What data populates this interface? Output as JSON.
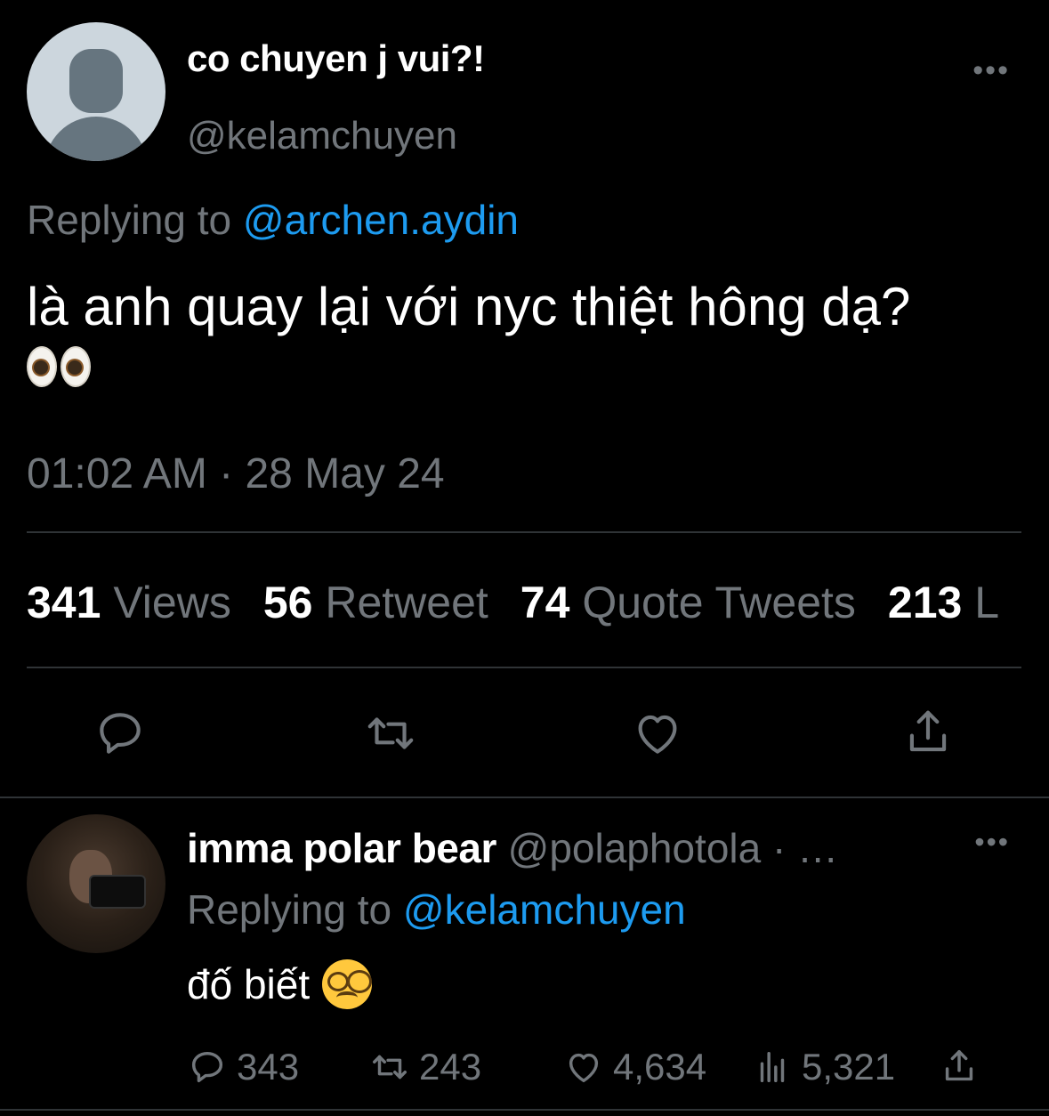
{
  "tweet": {
    "display_name": "co chuyen j vui?!",
    "handle": "@kelamchuyen",
    "more_label": "•••",
    "replying_prefix": "Replying to ",
    "replying_to": "@archen.aydin",
    "text": "là anh quay lại với nyc thiệt hông dạ?",
    "emoji": "eyes",
    "timestamp": "01:02 AM · 28 May 24",
    "stats": {
      "views_count": "341",
      "views_label": "Views",
      "retweet_count": "56",
      "retweet_label": "Retweet",
      "quote_count": "74",
      "quote_label": "Quote Tweets",
      "likes_count": "213",
      "likes_label": "L"
    },
    "actions": [
      "reply-icon",
      "retweet-icon",
      "like-icon",
      "share-icon"
    ]
  },
  "reply": {
    "display_name": "imma polar bear",
    "handle": "@polaphotola",
    "meta_suffix": "· …",
    "more_label": "•••",
    "replying_prefix": "Replying to ",
    "replying_to": "@kelamchuyen",
    "text": "đố biết",
    "emoji": "disguised-face",
    "actions": {
      "replies": "343",
      "retweets": "243",
      "likes": "4,634",
      "views": "5,321"
    }
  },
  "colors": {
    "background": "#000000",
    "text": "#e7e9ea",
    "muted": "#71767b",
    "accent": "#1d9bf0",
    "divider": "#2f3336"
  }
}
